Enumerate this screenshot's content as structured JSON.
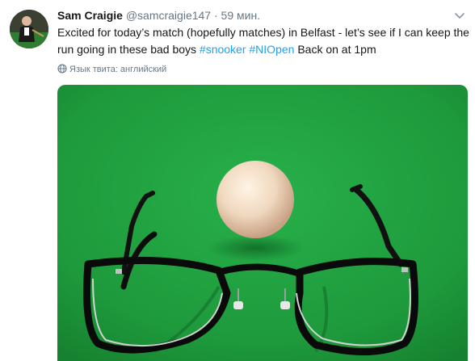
{
  "tweet": {
    "author_name": "Sam Craigie",
    "handle": "@samcraigie147",
    "separator": "·",
    "time": "59 мин.",
    "text_main": "Excited for today’s match (hopefully matches) in Belfast - let’s see if I can keep the run going in these bad boys ",
    "hashtag_1": "#snooker",
    "hashtag_2": "#NIOpen",
    "text_tail": " Back on at 1pm",
    "language_note": "Язык твита: английский",
    "caret_icon": "chevron-down-icon",
    "globe_icon": "globe-icon"
  },
  "colors": {
    "link": "#1da1f2",
    "secondary_text": "#657786",
    "table_felt": "#1f9a3c"
  }
}
